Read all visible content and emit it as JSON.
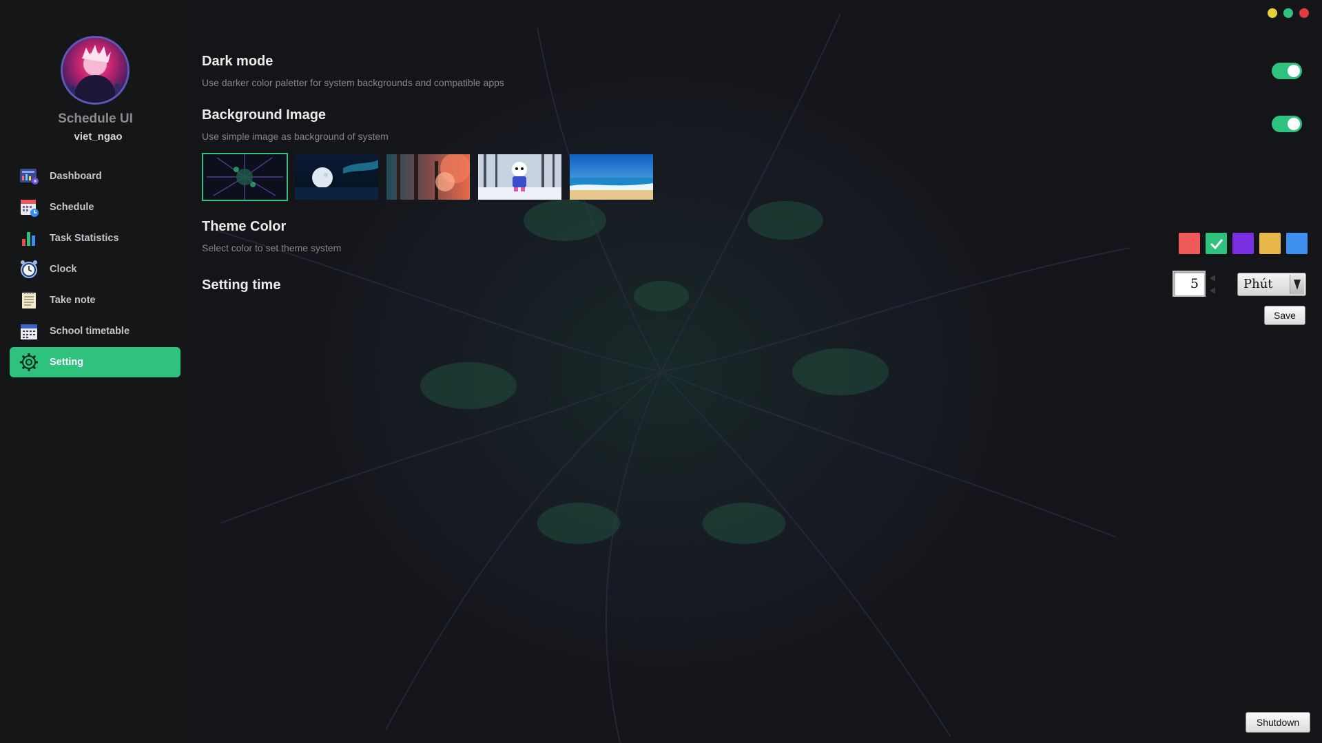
{
  "window_controls": {
    "minimize_color": "#e6d038",
    "maximize_color": "#2ec27e",
    "close_color": "#e23b3b"
  },
  "sidebar": {
    "app_name": "Schedule UI",
    "username": "viet_ngao",
    "items": [
      {
        "label": "Dashboard",
        "icon": "dashboard-chart-icon",
        "active": false
      },
      {
        "label": "Schedule",
        "icon": "calendar-clock-icon",
        "active": false
      },
      {
        "label": "Task Statistics",
        "icon": "bar-chart-icon",
        "active": false
      },
      {
        "label": "Clock",
        "icon": "alarm-clock-icon",
        "active": false
      },
      {
        "label": "Take note",
        "icon": "notepad-icon",
        "active": false
      },
      {
        "label": "School timetable",
        "icon": "timetable-calendar-icon",
        "active": false
      },
      {
        "label": "Setting",
        "icon": "gear-icon",
        "active": true
      }
    ]
  },
  "settings": {
    "dark_mode": {
      "title": "Dark mode",
      "description": "Use darker color paletter for system backgrounds and compatible apps",
      "enabled": true
    },
    "background_image": {
      "title": "Background Image",
      "description": "Use simple image as background of system",
      "enabled": true,
      "options": [
        "fractal",
        "moon-aurora",
        "autumn-forest",
        "snow-character",
        "beach"
      ],
      "selected_index": 0
    },
    "theme_color": {
      "title": "Theme Color",
      "description": "Select color to set theme system",
      "colors": [
        "#f05a5a",
        "#2ec27e",
        "#7a2fe0",
        "#e8b94a",
        "#3d8ff0"
      ],
      "selected_index": 1
    },
    "setting_time": {
      "title": "Setting time",
      "value": "5",
      "unit": "Phút",
      "save_label": "Save"
    }
  },
  "footer": {
    "shutdown_label": "Shutdown"
  },
  "colors": {
    "accent": "#2ec27e",
    "background": "#141518"
  }
}
